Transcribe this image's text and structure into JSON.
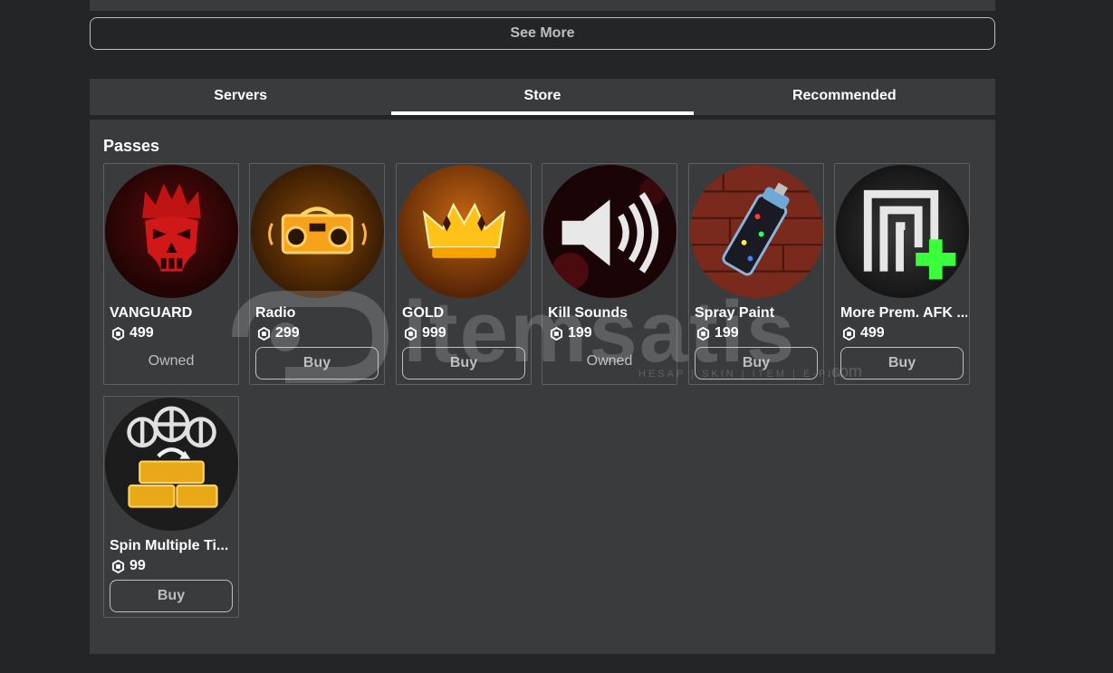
{
  "see_more_label": "See More",
  "tabs": [
    {
      "label": "Servers",
      "active": false
    },
    {
      "label": "Store",
      "active": true
    },
    {
      "label": "Recommended",
      "active": false
    }
  ],
  "section_title": "Passes",
  "passes": [
    {
      "name": "VANGUARD",
      "price": "499",
      "status": "Owned",
      "art": "skull-crown"
    },
    {
      "name": "Radio",
      "price": "299",
      "button": "Buy",
      "art": "boombox"
    },
    {
      "name": "GOLD",
      "price": "999",
      "button": "Buy",
      "art": "gold-crown"
    },
    {
      "name": "Kill Sounds",
      "price": "199",
      "status": "Owned",
      "art": "speaker"
    },
    {
      "name": "Spray Paint",
      "price": "199",
      "button": "Buy",
      "art": "spray-can"
    },
    {
      "name": "More Prem. AFK ...",
      "price": "499",
      "button": "Buy",
      "art": "afk-plus"
    },
    {
      "name": "Spin Multiple Ti...",
      "price": "99",
      "button": "Buy",
      "art": "spin-crates"
    }
  ],
  "watermark": {
    "text": "itemsatis",
    "subtext": "HESAP | SKIN | ITEM | E-PIN",
    "suffix": ".com"
  },
  "colors": {
    "background": "#232527",
    "panel": "#393b3d",
    "text": "#ffffff",
    "muted": "#bdbebe"
  }
}
